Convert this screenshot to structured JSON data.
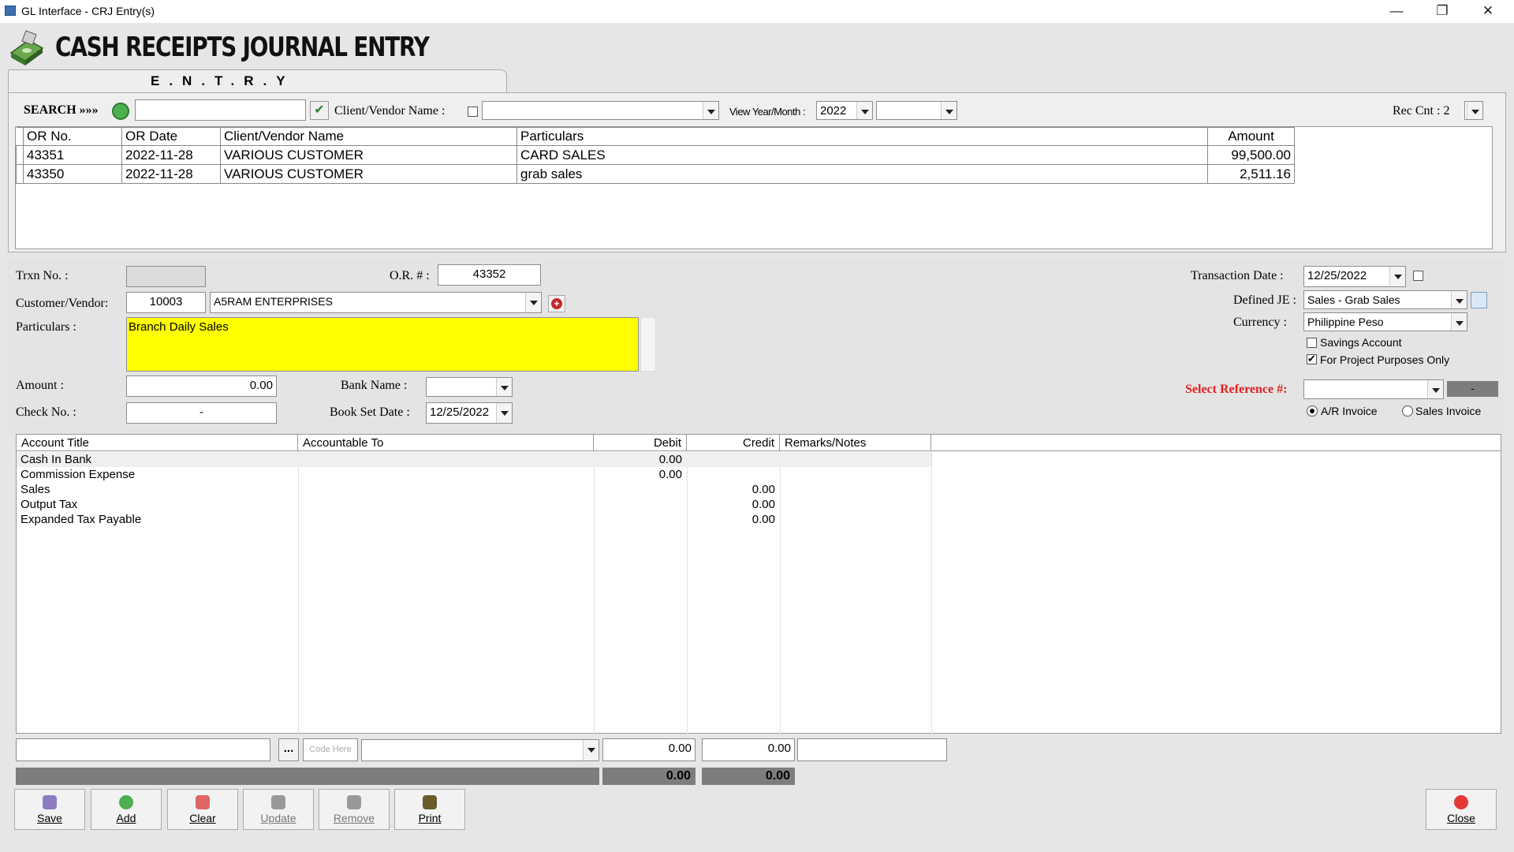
{
  "window": {
    "title": "GL Interface - CRJ Entry(s)"
  },
  "header": {
    "title": "CASH RECEIPTS JOURNAL ENTRY",
    "tab_label": "E.N.T.R.Y"
  },
  "search": {
    "label": "SEARCH »»»",
    "value": "",
    "client_vendor_label": "Client/Vendor Name :",
    "client_vendor_value": "",
    "view_label": "View Year/Month :",
    "year": "2022",
    "month": "",
    "rec_count": "Rec Cnt : 2"
  },
  "records": {
    "columns": [
      "OR No.",
      "OR Date",
      "Client/Vendor Name",
      "Particulars",
      "Amount"
    ],
    "rows": [
      [
        "43351",
        "2022-11-28",
        "VARIOUS CUSTOMER",
        "CARD SALES",
        "99,500.00"
      ],
      [
        "43350",
        "2022-11-28",
        "VARIOUS CUSTOMER",
        "grab sales",
        "2,511.16"
      ]
    ]
  },
  "form": {
    "trxn_label": "Trxn No. :",
    "trxn_value": "",
    "or_label": "O.R. # :",
    "or_value": "43352",
    "customer_label": "Customer/Vendor:",
    "customer_code": "10003",
    "customer_name": "A5RAM ENTERPRISES",
    "particulars_label": "Particulars :",
    "particulars_value": "Branch Daily Sales",
    "amount_label": "Amount :",
    "amount_value": "0.00",
    "bank_label": "Bank Name :",
    "bank_value": "",
    "check_label": "Check No. :",
    "check_value": "-",
    "book_date_label": "Book Set Date :",
    "book_date_value": "12/25/2022",
    "trans_date_label": "Transaction Date :",
    "trans_date_value": "12/25/2022",
    "defined_je_label": "Defined JE :",
    "defined_je_value": "Sales - Grab Sales",
    "currency_label": "Currency :",
    "currency_value": "Philippine Peso",
    "savings_label": "Savings Account",
    "project_label": "For Project Purposes Only",
    "select_ref_label": "Select Reference #:",
    "select_ref_value": "",
    "ref_status": "-",
    "radio_ar": "A/R Invoice",
    "radio_si": "Sales Invoice"
  },
  "entries": {
    "columns": [
      "Account Title",
      "Accountable To",
      "Debit",
      "Credit",
      "Remarks/Notes"
    ],
    "rows": [
      {
        "account": "Cash In Bank",
        "accountable": "",
        "debit": "0.00",
        "credit": "",
        "remarks": ""
      },
      {
        "account": "Commission Expense",
        "accountable": "",
        "debit": "0.00",
        "credit": "",
        "remarks": ""
      },
      {
        "account": "Sales",
        "accountable": "",
        "debit": "",
        "credit": "0.00",
        "remarks": ""
      },
      {
        "account": "Output Tax",
        "accountable": "",
        "debit": "",
        "credit": "0.00",
        "remarks": ""
      },
      {
        "account": "Expanded Tax Payable",
        "accountable": "",
        "debit": "",
        "credit": "0.00",
        "remarks": ""
      }
    ]
  },
  "entry_line": {
    "account_value": "",
    "ellipsis": "...",
    "code_placeholder": "Code Here",
    "accountable_value": "",
    "debit_value": "0.00",
    "credit_value": "0.00",
    "remarks_value": ""
  },
  "totals": {
    "debit": "0.00",
    "credit": "0.00"
  },
  "buttons": {
    "save": "Save",
    "add": "Add",
    "clear": "Clear",
    "update": "Update",
    "remove": "Remove",
    "print": "Print",
    "close": "Close"
  },
  "colors": {
    "particulars_bg": "#ffff00",
    "select_ref_label": "#e02020",
    "totals_bar": "#7d7d7d"
  }
}
